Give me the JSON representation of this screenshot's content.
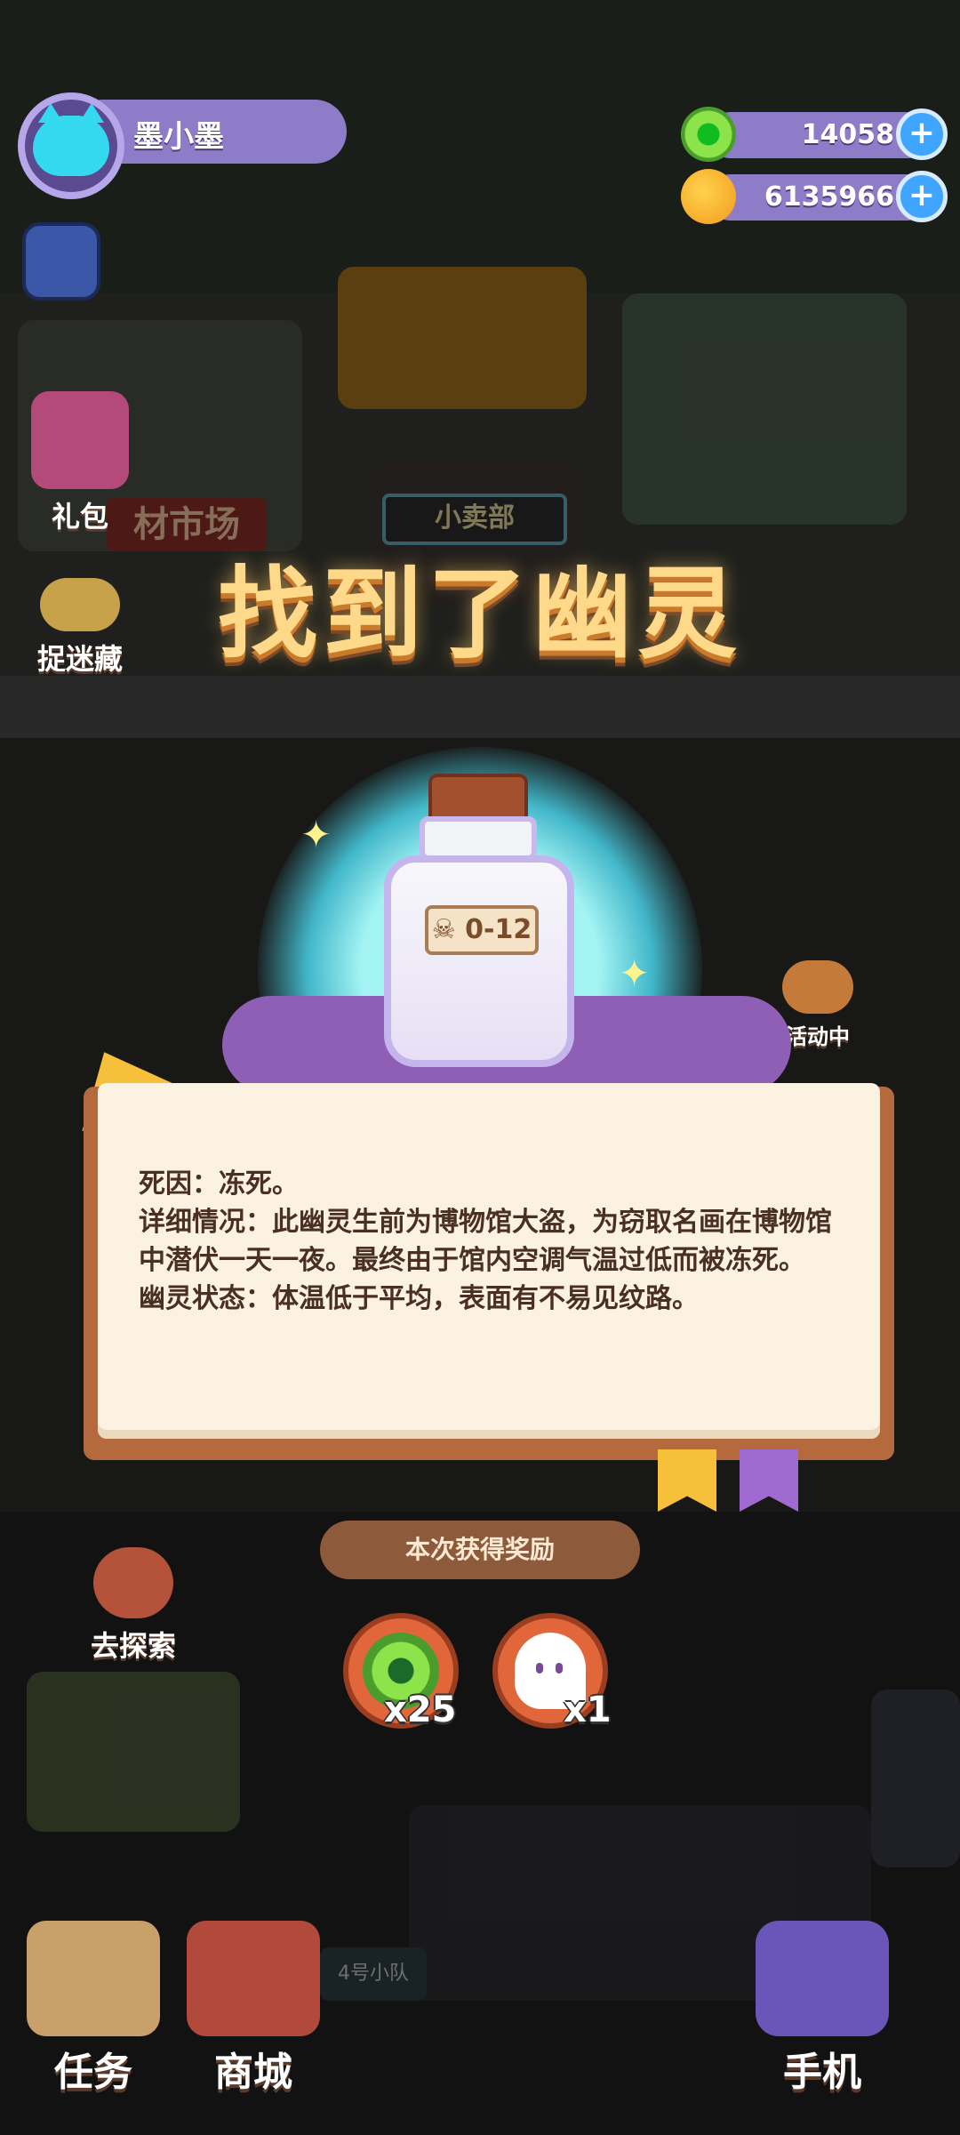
{
  "player": {
    "name": "墨小墨"
  },
  "currencies": [
    {
      "name": "donut-currency",
      "value": "14058"
    },
    {
      "name": "coin-currency",
      "value": "6135966"
    }
  ],
  "side_buttons": {
    "gift": "礼包",
    "hide_seek": "捉迷藏",
    "explore": "去探索",
    "event": "活动中"
  },
  "scene_labels": {
    "shop": "小卖部",
    "market": "材市场",
    "team": "4号小队"
  },
  "modal": {
    "title": "找到了幽灵",
    "bottle_tag": "0-12",
    "death_cause": "死因：冻死。",
    "detail": "详细情况：此幽灵生前为博物馆大盗，为窃取名画在博物馆中潜伏一天一夜。最终由于馆内空调气温过低而被冻死。",
    "status": "幽灵状态：体温低于平均，表面有不易见纹路。",
    "reward_label": "本次获得奖励",
    "rewards": [
      {
        "name": "donut",
        "qty": "x25"
      },
      {
        "name": "ghost",
        "qty": "x1"
      }
    ]
  },
  "nav": {
    "tasks": "任务",
    "shop": "商城",
    "phone": "手机"
  }
}
